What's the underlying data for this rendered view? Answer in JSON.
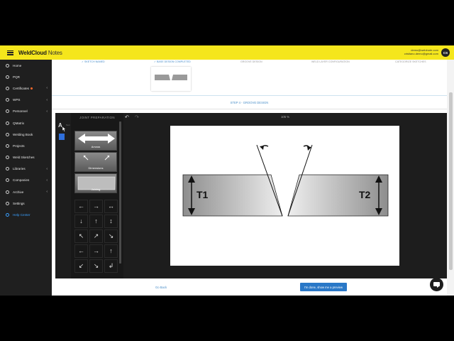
{
  "app": {
    "brand": "WeldCloud",
    "brand_suffix": "Notes"
  },
  "user": {
    "email": "demo@weldnote.com",
    "sub_email": "cristiano.demo@gmail.com",
    "initials": "CS"
  },
  "sidebar": {
    "items": [
      {
        "label": "Home",
        "chevron": ""
      },
      {
        "label": "PQR",
        "chevron": ""
      },
      {
        "label": "Certificates",
        "chevron": "‹",
        "badge": true
      },
      {
        "label": "WPS",
        "chevron": "‹"
      },
      {
        "label": "Personnel",
        "chevron": "‹"
      },
      {
        "label": "QMatrix",
        "chevron": ""
      },
      {
        "label": "Welding Book",
        "chevron": ""
      },
      {
        "label": "Projects",
        "chevron": ""
      },
      {
        "label": "Weld Sketches",
        "chevron": ""
      },
      {
        "label": "Libraries",
        "chevron": "‹"
      },
      {
        "label": "Companies",
        "chevron": "‹"
      },
      {
        "label": "Archive",
        "chevron": "‹"
      },
      {
        "label": "Settings",
        "chevron": ""
      },
      {
        "label": "Help Center",
        "chevron": ""
      }
    ]
  },
  "steps": [
    {
      "label": "✓ SKETCH NAMED",
      "state": "done"
    },
    {
      "label": "✓ BASE DESIGN COMPLETED",
      "state": "done"
    },
    {
      "label": "GROOVE DESIGN",
      "state": "todo"
    },
    {
      "label": "WELD LAYER CONFIGURATION",
      "state": "todo"
    },
    {
      "label": "CATEGORIZE SKETCHES",
      "state": "todo"
    }
  ],
  "current_step": "STEP 4 - GROOVE DESIGN",
  "editor": {
    "palette_title": "JOINT PREPARATION",
    "text_tool_label": "Text",
    "tiles": {
      "arrows": "Arrows",
      "dimension": "Dimensions",
      "joint": "Joining"
    },
    "undo_icon": "undo-icon",
    "redo_icon": "redo-icon",
    "zoom": "105 %",
    "arrow_glyphs": [
      "←",
      "→",
      "↔",
      "↓",
      "↑",
      "↕",
      "↖",
      "↗",
      "↘",
      "←",
      "→",
      "↑",
      "↙",
      "↘",
      "↲"
    ]
  },
  "canvas": {
    "label_left": "T1",
    "label_right": "T2"
  },
  "footer": {
    "go_back": "Go Back",
    "done": "I'm done, show me a preview"
  },
  "colors": {
    "topbar": "#f5e61c",
    "sidebar": "#1f1f1f",
    "accent": "#2a78c7"
  }
}
